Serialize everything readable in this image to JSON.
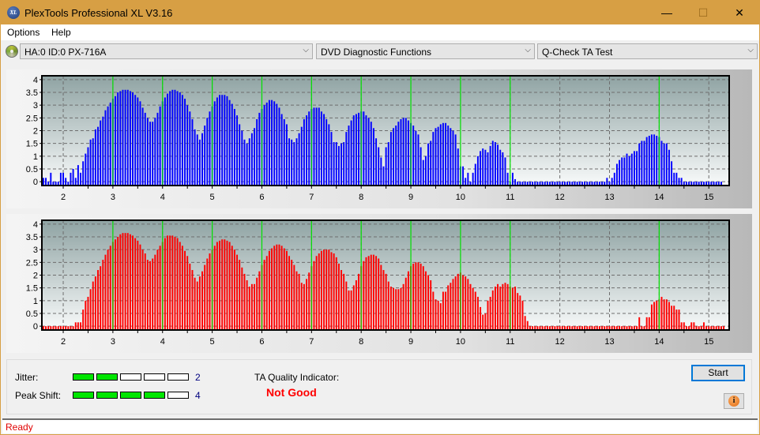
{
  "window": {
    "title": "PlexTools Professional XL V3.16",
    "app_icon_text": "XL",
    "controls": {
      "minimize": "—",
      "maximize": "☐",
      "close": "✕"
    }
  },
  "menu": [
    "Options",
    "Help"
  ],
  "toolbar": {
    "drive": "HA:0 ID:0  PX-716A",
    "function_group": "DVD Diagnostic Functions",
    "test": "Q-Check TA Test",
    "chevron": "⌵"
  },
  "colors": {
    "titlebar": "#d79f44",
    "series1": "#0000ff",
    "series2": "#ff0000",
    "marker": "#00e000",
    "meter_on": "#00e600",
    "bad": "#ff0000"
  },
  "chart_data": [
    {
      "type": "bar",
      "name": "TA distribution (top)",
      "title": "",
      "xlabel": "",
      "ylabel": "",
      "xlim": [
        1.57,
        15.41
      ],
      "ylim": [
        -0.15,
        4.15
      ],
      "x_ticks": [
        2,
        3,
        4,
        5,
        6,
        7,
        8,
        9,
        10,
        11,
        12,
        13,
        14,
        15
      ],
      "y_ticks": [
        "0",
        "0.5",
        "1",
        "1.5",
        "2",
        "2.5",
        "3",
        "3.5",
        "4"
      ],
      "y_tick_values": [
        0,
        0.5,
        1,
        1.5,
        2,
        2.5,
        3,
        3.5,
        4
      ],
      "markers": [
        3,
        4,
        5,
        6,
        7,
        8,
        9,
        10,
        11,
        14
      ],
      "grid": true,
      "color": "#0000ff",
      "x_start": 1.6,
      "x_step": 0.05,
      "values": [
        0.15,
        0.15,
        0,
        0.35,
        0,
        0,
        0,
        0.35,
        0.35,
        0.15,
        0,
        0.35,
        0.5,
        0.15,
        0.65,
        0.35,
        0.8,
        1.1,
        1.35,
        1.65,
        1.7,
        2.05,
        2.15,
        2.4,
        2.55,
        2.8,
        2.95,
        3.1,
        3.25,
        3.35,
        3.5,
        3.55,
        3.6,
        3.6,
        3.6,
        3.55,
        3.5,
        3.4,
        3.3,
        3.15,
        2.9,
        2.7,
        2.5,
        2.35,
        2.35,
        2.5,
        2.7,
        2.95,
        3.15,
        3.3,
        3.45,
        3.55,
        3.6,
        3.6,
        3.55,
        3.5,
        3.4,
        3.25,
        3.0,
        2.75,
        2.45,
        2.05,
        1.85,
        1.65,
        1.9,
        2.2,
        2.5,
        2.75,
        2.95,
        3.15,
        3.3,
        3.4,
        3.4,
        3.4,
        3.35,
        3.2,
        3.05,
        2.85,
        2.6,
        2.25,
        2.0,
        1.65,
        1.5,
        1.7,
        1.9,
        2.1,
        2.45,
        2.7,
        2.85,
        3.0,
        3.1,
        3.2,
        3.2,
        3.15,
        3.05,
        2.9,
        2.65,
        2.45,
        2.25,
        1.7,
        1.65,
        1.55,
        1.7,
        1.9,
        2.15,
        2.45,
        2.6,
        2.75,
        2.85,
        2.9,
        2.9,
        2.9,
        2.75,
        2.65,
        2.45,
        2.25,
        1.95,
        1.55,
        1.55,
        1.4,
        1.5,
        1.55,
        1.95,
        2.2,
        2.4,
        2.6,
        2.65,
        2.7,
        2.75,
        2.75,
        2.6,
        2.5,
        2.35,
        2.1,
        1.7,
        1.35,
        0.95,
        0.6,
        1.35,
        1.55,
        1.95,
        2.1,
        2.2,
        2.35,
        2.45,
        2.5,
        2.5,
        2.4,
        2.3,
        2.2,
        2.0,
        1.85,
        1.35,
        0.85,
        1.0,
        1.5,
        1.6,
        1.95,
        2.1,
        2.15,
        2.25,
        2.3,
        2.3,
        2.2,
        2.1,
        2.0,
        1.85,
        1.3,
        0.6,
        0.6,
        0.15,
        0.35,
        0,
        0.35,
        0.7,
        1.0,
        1.2,
        1.3,
        1.25,
        1.15,
        1.4,
        1.6,
        1.55,
        1.45,
        1.25,
        1.15,
        0.95,
        0.35,
        0,
        0.35,
        0.1,
        0,
        0,
        0,
        0,
        0,
        0,
        0,
        0,
        0,
        0,
        0,
        0,
        0,
        0,
        0,
        0,
        0,
        0,
        0,
        0,
        0,
        0,
        0,
        0,
        0,
        0,
        0,
        0,
        0,
        0,
        0,
        0,
        0,
        0,
        0,
        0,
        0.15,
        0,
        0.15,
        0.35,
        0.7,
        0.85,
        0.95,
        0.95,
        1.1,
        1.0,
        1.1,
        1.2,
        1.2,
        1.5,
        1.6,
        1.6,
        1.75,
        1.8,
        1.85,
        1.85,
        1.8,
        1.75,
        1.6,
        1.5,
        1.5,
        1.25,
        0.8,
        0.35,
        0.35,
        0.15,
        0.15,
        0,
        0,
        0,
        0,
        0,
        0,
        0,
        0,
        0,
        0,
        0,
        0,
        0,
        0,
        0,
        0
      ]
    },
    {
      "type": "bar",
      "name": "TA distribution (bottom)",
      "title": "",
      "xlabel": "",
      "ylabel": "",
      "xlim": [
        1.57,
        15.41
      ],
      "ylim": [
        -0.15,
        4.15
      ],
      "x_ticks": [
        2,
        3,
        4,
        5,
        6,
        7,
        8,
        9,
        10,
        11,
        12,
        13,
        14,
        15
      ],
      "y_ticks": [
        "0",
        "0.5",
        "1",
        "1.5",
        "2",
        "2.5",
        "3",
        "3.5",
        "4"
      ],
      "y_tick_values": [
        0,
        0.5,
        1,
        1.5,
        2,
        2.5,
        3,
        3.5,
        4
      ],
      "markers": [
        3,
        4,
        5,
        6,
        7,
        8,
        9,
        10,
        11,
        14
      ],
      "grid": true,
      "color": "#ff0000",
      "x_start": 1.6,
      "x_step": 0.05,
      "values": [
        0,
        0,
        0,
        0,
        0,
        0,
        0,
        0,
        0,
        0,
        0,
        0,
        0,
        0.15,
        0.15,
        0.15,
        0.65,
        1.0,
        1.15,
        1.45,
        1.75,
        1.95,
        2.2,
        2.35,
        2.6,
        2.8,
        3.0,
        3.15,
        3.3,
        3.4,
        3.5,
        3.6,
        3.65,
        3.65,
        3.65,
        3.6,
        3.55,
        3.45,
        3.35,
        3.2,
        3.0,
        2.85,
        2.6,
        2.55,
        2.65,
        2.8,
        3.0,
        3.15,
        3.3,
        3.45,
        3.55,
        3.55,
        3.55,
        3.5,
        3.45,
        3.3,
        3.15,
        2.95,
        2.75,
        2.45,
        2.2,
        1.9,
        1.75,
        1.95,
        2.15,
        2.4,
        2.65,
        2.85,
        3.0,
        3.15,
        3.3,
        3.35,
        3.4,
        3.4,
        3.35,
        3.3,
        3.15,
        3.0,
        2.8,
        2.6,
        2.3,
        2.05,
        1.8,
        1.55,
        1.65,
        1.65,
        1.9,
        2.15,
        2.4,
        2.6,
        2.75,
        2.95,
        3.05,
        3.15,
        3.2,
        3.2,
        3.15,
        3.05,
        2.95,
        2.75,
        2.6,
        2.4,
        2.15,
        2.05,
        1.7,
        1.65,
        1.85,
        2.1,
        2.35,
        2.55,
        2.75,
        2.85,
        2.95,
        3.0,
        3.0,
        3.0,
        2.9,
        2.85,
        2.7,
        2.45,
        2.2,
        2.05,
        1.75,
        1.4,
        1.4,
        1.6,
        1.8,
        2.05,
        2.35,
        2.55,
        2.7,
        2.75,
        2.8,
        2.8,
        2.75,
        2.65,
        2.4,
        2.2,
        2.05,
        1.75,
        1.55,
        1.5,
        1.45,
        1.45,
        1.5,
        1.65,
        1.9,
        2.15,
        2.35,
        2.45,
        2.5,
        2.5,
        2.45,
        2.35,
        2.15,
        2.0,
        1.8,
        1.35,
        1.05,
        1.0,
        0.9,
        1.35,
        1.35,
        1.6,
        1.7,
        1.85,
        1.95,
        2.05,
        2.1,
        2.0,
        1.95,
        1.85,
        1.65,
        1.5,
        1.35,
        1.15,
        0.75,
        0.45,
        0.5,
        1.0,
        1.15,
        1.4,
        1.55,
        1.65,
        1.55,
        1.65,
        1.7,
        1.65,
        1.55,
        1.5,
        1.55,
        1.3,
        1.2,
        1.0,
        0.4,
        0.2,
        0,
        0,
        0,
        0,
        0,
        0,
        0,
        0,
        0,
        0,
        0,
        0,
        0,
        0,
        0,
        0,
        0,
        0,
        0,
        0,
        0,
        0,
        0,
        0,
        0,
        0,
        0,
        0,
        0,
        0,
        0,
        0,
        0,
        0,
        0,
        0,
        0,
        0,
        0,
        0,
        0,
        0,
        0,
        0,
        0.35,
        0,
        0,
        0.35,
        0.35,
        0.85,
        0.95,
        1.0,
        1.05,
        1.15,
        1.05,
        1.05,
        0.95,
        0.8,
        0.8,
        0.65,
        0.65,
        0.15,
        0.15,
        0,
        0,
        0.15,
        0.15,
        0,
        0,
        0,
        0.15,
        0,
        0,
        0,
        0,
        0,
        0,
        0,
        0
      ]
    }
  ],
  "results": {
    "jitter_label": "Jitter:",
    "jitter_value": 2,
    "jitter_max": 5,
    "peak_shift_label": "Peak Shift:",
    "peak_shift_value": 4,
    "peak_shift_max": 5,
    "ta_label": "TA Quality Indicator:",
    "ta_value": "Not Good"
  },
  "buttons": {
    "start": "Start",
    "info": "i"
  },
  "status": "Ready"
}
